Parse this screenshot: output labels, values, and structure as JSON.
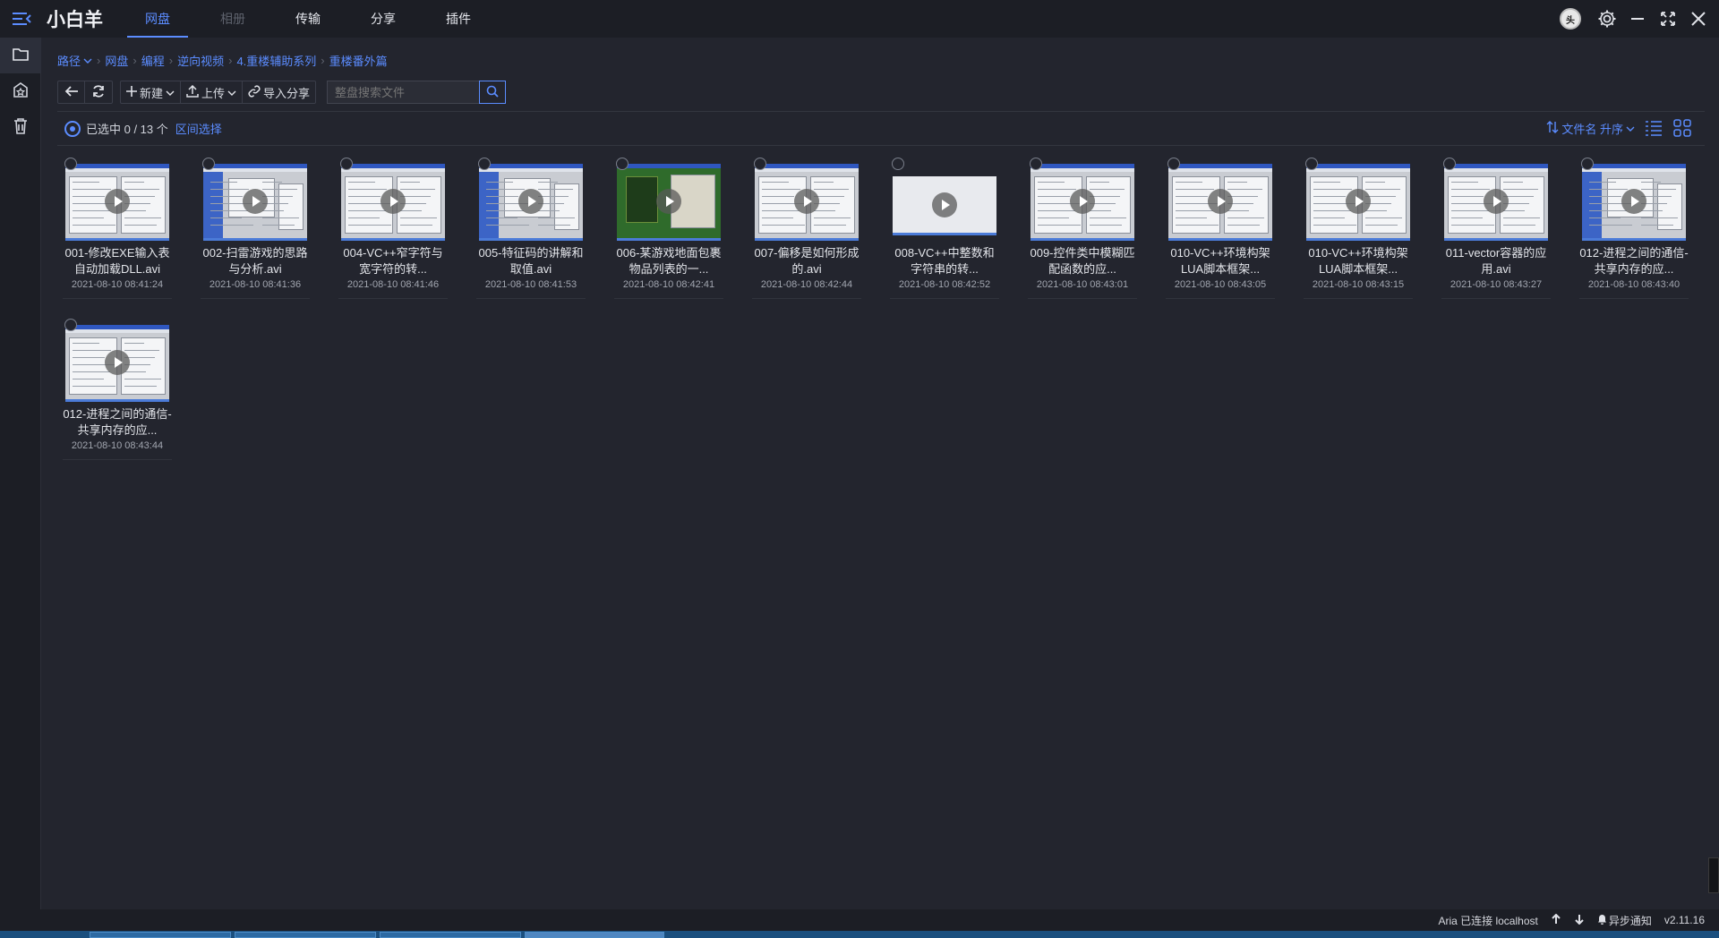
{
  "app": {
    "title": "小白羊"
  },
  "tabs": [
    {
      "label": "网盘",
      "state": "active"
    },
    {
      "label": "相册",
      "state": "disabled"
    },
    {
      "label": "传输",
      "state": "normal"
    },
    {
      "label": "分享",
      "state": "normal"
    },
    {
      "label": "插件",
      "state": "normal"
    }
  ],
  "avatar_text": "头",
  "breadcrumb": [
    "路径",
    "网盘",
    "编程",
    "逆向视频",
    "4.重楼辅助系列",
    "重楼番外篇"
  ],
  "toolbar": {
    "new_label": "新建",
    "upload_label": "上传",
    "import_label": "导入分享",
    "search_placeholder": "整盘搜索文件"
  },
  "selection": {
    "text": "已选中 0 / 13 个",
    "range_label": "区间选择"
  },
  "sort": {
    "label": "文件名 升序"
  },
  "files": [
    {
      "name": "001-修改EXE输入表自动加载DLL.avi",
      "date": "2021-08-10 08:41:24",
      "thumb": "ide"
    },
    {
      "name": "002-扫雷游戏的思路与分析.avi",
      "date": "2021-08-10 08:41:36",
      "thumb": "dialog"
    },
    {
      "name": "004-VC++窄字符与宽字符的转...",
      "date": "2021-08-10 08:41:46",
      "thumb": "ide"
    },
    {
      "name": "005-特征码的讲解和取值.avi",
      "date": "2021-08-10 08:41:53",
      "thumb": "dialog"
    },
    {
      "name": "006-某游戏地面包裹物品列表的一...",
      "date": "2021-08-10 08:42:41",
      "thumb": "game"
    },
    {
      "name": "007-偏移是如何形成的.avi",
      "date": "2021-08-10 08:42:44",
      "thumb": "ide"
    },
    {
      "name": "008-VC++中整数和字符串的转...",
      "date": "2021-08-10 08:42:52",
      "thumb": "blank"
    },
    {
      "name": "009-控件类中模糊匹配函数的应...",
      "date": "2021-08-10 08:43:01",
      "thumb": "ide"
    },
    {
      "name": "010-VC++环境构架LUA脚本框架...",
      "date": "2021-08-10 08:43:05",
      "thumb": "ide"
    },
    {
      "name": "010-VC++环境构架LUA脚本框架...",
      "date": "2021-08-10 08:43:15",
      "thumb": "ide"
    },
    {
      "name": "011-vector容器的应用.avi",
      "date": "2021-08-10 08:43:27",
      "thumb": "ide"
    },
    {
      "name": "012-进程之间的通信-共享内存的应...",
      "date": "2021-08-10 08:43:40",
      "thumb": "dialog"
    },
    {
      "name": "012-进程之间的通信-共享内存的应...",
      "date": "2021-08-10 08:43:44",
      "thumb": "ide"
    }
  ],
  "status": {
    "aria": "Aria 已连接 localhost",
    "notify": "异步通知",
    "version": "v2.11.16"
  },
  "colors": {
    "accent": "#5b8cff",
    "background": "#23252e",
    "bar": "#1c1e25"
  }
}
